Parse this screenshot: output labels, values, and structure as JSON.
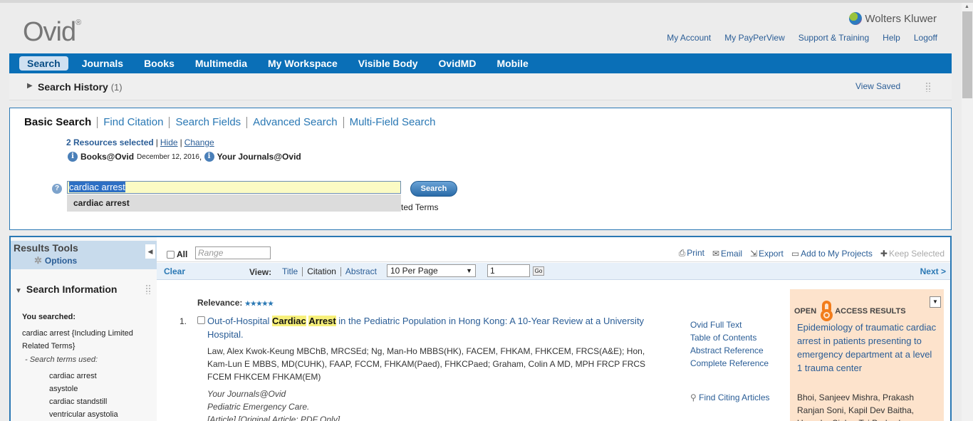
{
  "header": {
    "logo": "Ovid",
    "logo_mark": "®",
    "brand": "Wolters Kluwer",
    "links": [
      "My Account",
      "My PayPerView",
      "Support & Training",
      "Help",
      "Logoff"
    ]
  },
  "nav": {
    "items": [
      "Search",
      "Journals",
      "Books",
      "Multimedia",
      "My Workspace",
      "Visible Body",
      "OvidMD",
      "Mobile"
    ],
    "active": "Search"
  },
  "history": {
    "label": "Search History",
    "count": "(1)",
    "view_saved": "View Saved"
  },
  "search": {
    "tabs": [
      "Basic Search",
      "Find Citation",
      "Search Fields",
      "Advanced Search",
      "Multi-Field Search"
    ],
    "resources_selected": "2 Resources selected",
    "hide": "Hide",
    "change": "Change",
    "db1": "Books@Ovid",
    "db1_date": "December 12, 2016",
    "db2": "Your Journals@Ovid",
    "query": "cardiac arrest",
    "button": "Search",
    "suggestion": "cardiac arrest",
    "related_fragment": "ted Terms"
  },
  "results_tools": {
    "title": "Results Tools",
    "options": "Options",
    "search_info": "Search Information",
    "you_searched": "You searched:",
    "query_desc": "cardiac arrest {Including Limited Related Terms}",
    "terms_heading": "- Search terms used:",
    "terms": [
      "cardiac arrest",
      "asystole",
      "cardiac standstill",
      "ventricular asystolia"
    ]
  },
  "toolbar": {
    "all": "All",
    "range_placeholder": "Range",
    "print": "Print",
    "email": "Email",
    "export": "Export",
    "add_projects": "Add to My Projects",
    "keep_selected": "Keep Selected"
  },
  "viewbar": {
    "clear": "Clear",
    "view": "View:",
    "title": "Title",
    "citation": "Citation",
    "abstract": "Abstract",
    "per_page": "10 Per Page",
    "page": "1",
    "go": "Go",
    "next": "Next >"
  },
  "result": {
    "relevance": "Relevance:",
    "stars": "★★★★★",
    "number": "1.",
    "title_pre": "Out-of-Hospital ",
    "title_hl1": "Cardiac",
    "title_hl2": "Arrest",
    "title_post": " in the Pediatric Population in Hong Kong: A 10-Year Review at a University Hospital.",
    "authors": "Law, Alex Kwok-Keung MBChB, MRCSEd; Ng, Man-Ho MBBS(HK), FACEM, FHKAM, FHKCEM, FRCS(A&E); Hon, Kam-Lun E MBBS, MD(CUHK), FAAP, FCCM, FHKAM(Paed), FHKCPaed; Graham, Colin A MD, MPH FRCP FRCS FCEM FHKCEM FHKAM(EM)",
    "source1": "Your Journals@Ovid",
    "source2": "Pediatric Emergency Care.",
    "source3": "[Article] [Original Article: PDF Only]",
    "links": [
      "Ovid Full Text",
      "Table of Contents",
      "Abstract Reference",
      "Complete Reference"
    ],
    "citing": "Find Citing Articles"
  },
  "open_access": {
    "open": "OPEN",
    "access": "ACCESS RESULTS",
    "title": "Epidemiology of traumatic cardiac arrest in patients presenting to emergency department at a level 1 trauma center",
    "authors": "Bhoi, Sanjeev Mishra, Prakash Ranjan Soni, Kapil Dev Baitha, Upendra Sinha, Tej Prakash"
  }
}
